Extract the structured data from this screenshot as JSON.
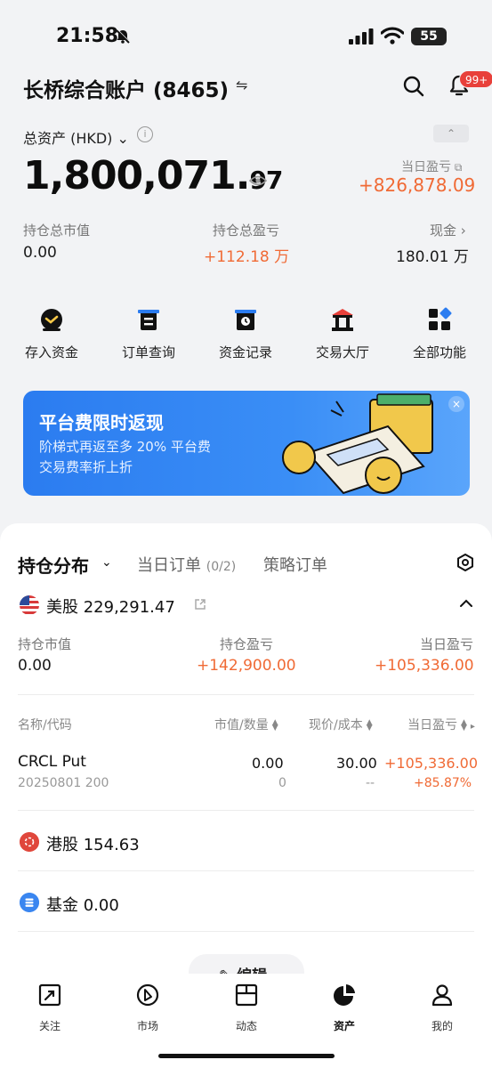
{
  "status_bar": {
    "time": "21:58",
    "battery": "55"
  },
  "header": {
    "account_title": "长桥综合账户 (8465)",
    "swap_glyph": "⇋",
    "notification_badge": "99+"
  },
  "summary": {
    "total_label": "总资产 (HKD)",
    "total_integer": "1,800,071.",
    "total_decimal": "97",
    "daily_pnl_label": "当日盈亏",
    "daily_pnl_value": "+826,878.09",
    "holdings_mv_label": "持仓总市值",
    "holdings_mv_value": "0.00",
    "holdings_pnl_label": "持仓总盈亏",
    "holdings_pnl_value": "+112.18 万",
    "cash_label": "现金",
    "cash_value": "180.01 万"
  },
  "quick_actions": [
    {
      "label": "存入资金",
      "icon": "deposit-icon"
    },
    {
      "label": "订单查询",
      "icon": "order-icon"
    },
    {
      "label": "资金记录",
      "icon": "record-icon"
    },
    {
      "label": "交易大厅",
      "icon": "hall-icon"
    },
    {
      "label": "全部功能",
      "icon": "grid-icon"
    }
  ],
  "banner": {
    "title": "平台费限时返现",
    "line1": "阶梯式再返至多 20% 平台费",
    "line2": "交易费率折上折",
    "close": "×"
  },
  "tabs": {
    "holdings": "持仓分布",
    "today_orders": "当日订单",
    "today_orders_count": "(0/2)",
    "strategy_orders": "策略订单"
  },
  "us_section": {
    "title": "美股 229,291.47",
    "mv_label": "持仓市值",
    "mv_value": "0.00",
    "pnl_label": "持仓盈亏",
    "pnl_value": "+142,900.00",
    "day_label": "当日盈亏",
    "day_value": "+105,336.00"
  },
  "table": {
    "headers": [
      "名称/代码",
      "市值/数量",
      "现价/成本",
      "当日盈亏"
    ],
    "rows": [
      {
        "name": "CRCL Put",
        "code": "20250801 200",
        "market_value": "0.00",
        "quantity": "0",
        "price": "30.00",
        "cost": "--",
        "day_pnl": "+105,336.00",
        "day_pnl_pct": "+85.87%"
      }
    ]
  },
  "hk_section": {
    "title": "港股 154.63"
  },
  "fund_section": {
    "title": "基金 0.00"
  },
  "edit_button": "编辑",
  "nav": [
    {
      "label": "关注",
      "icon": "watchlist-icon"
    },
    {
      "label": "市场",
      "icon": "market-icon"
    },
    {
      "label": "动态",
      "icon": "feed-icon"
    },
    {
      "label": "资产",
      "icon": "assets-icon",
      "active": true
    },
    {
      "label": "我的",
      "icon": "profile-icon"
    }
  ],
  "colors": {
    "gain": "#f06a35",
    "brand_blue": "#2b7cf0",
    "badge_red": "#e8403a"
  }
}
